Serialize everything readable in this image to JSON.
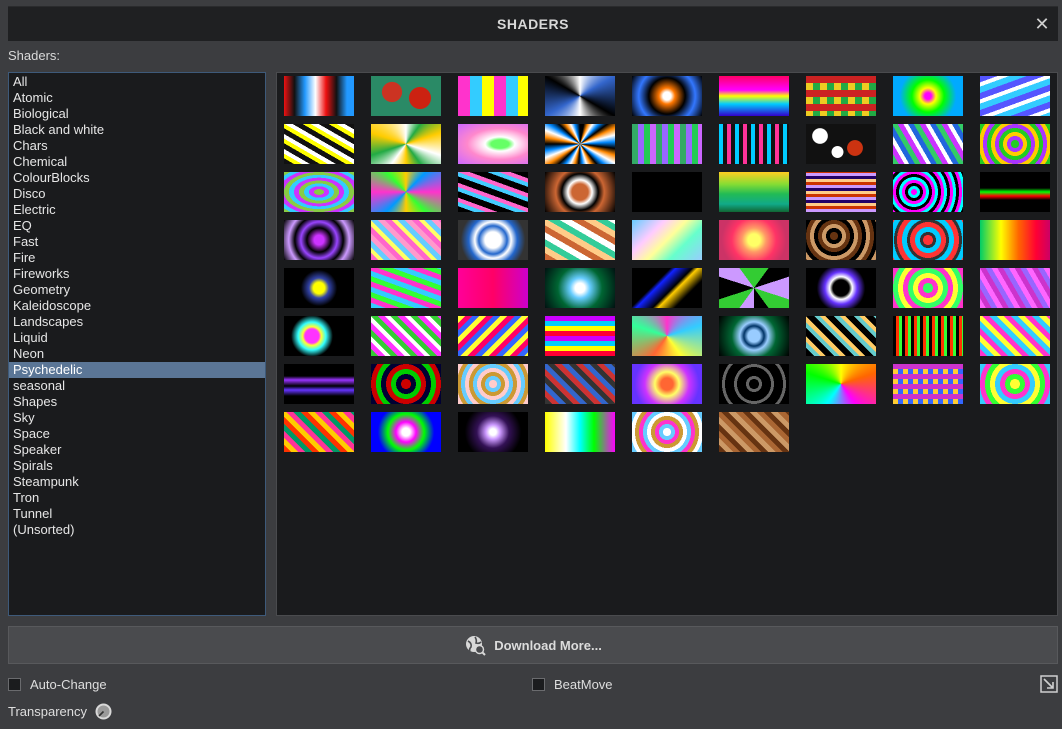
{
  "window": {
    "title": "SHADERS",
    "close_glyph": "✕"
  },
  "panel": {
    "shaders_label": "Shaders:"
  },
  "categories": {
    "selected": "Psychedelic",
    "items": [
      "All",
      "Atomic",
      "Biological",
      "Black and white",
      "Chars",
      "Chemical",
      "ColourBlocks",
      "Disco",
      "Electric",
      "EQ",
      "Fast",
      "Fire",
      "Fireworks",
      "Geometry",
      "Kaleidoscope",
      "Landscapes",
      "Liquid",
      "Neon",
      "Psychedelic",
      "seasonal",
      "Shapes",
      "Sky",
      "Space",
      "Speaker",
      "Spirals",
      "Steampunk",
      "Tron",
      "Tunnel",
      "(Unsorted)"
    ]
  },
  "thumbnails": [
    {
      "bg": "linear-gradient(90deg,#e11 0,#111 15%,#29f 30%,#fff 45%,#e11 60%,#111 75%,#29f 90%)"
    },
    {
      "bg": "radial-gradient(circle at 30% 40%,#c32 0 18%,transparent 19%),radial-gradient(circle at 70% 55%,#c21 0 20%,transparent 21%),#2a8a66"
    },
    {
      "bg": "repeating-linear-gradient(90deg,#f3c 0 12px,#3cf 12px 24px,#ff0 24px 36px)"
    },
    {
      "bg": "conic-gradient(#fff,#36c,#000,#fff,#36c,#000,#fff)"
    },
    {
      "bg": "radial-gradient(circle,#fff 0 10%,#f70 20%,#000 45%,#37f 70%,#000)"
    },
    {
      "bg": "linear-gradient(180deg,#f06 0,#f0f 35%,#ff0 50%,#0cf 70%,#30c 100%)"
    },
    {
      "bg": "repeating-conic-gradient(#c22 0 25%,#2a4 0 50%,#ec2 0 75%,#24c 0) 0 0/14px 14px"
    },
    {
      "bg": "radial-gradient(circle,#f0f 0 8%,#ff0 20%,#0f0 40%,#0af 70%)"
    },
    {
      "bg": "repeating-linear-gradient(160deg,#55f 0 6px,#fff 6px 10px,#3cf 10px 16px)"
    },
    {
      "bg": "repeating-linear-gradient(30deg,#111 0 5px,#ff0 5px 9px,#fff 9px 13px)"
    },
    {
      "bg": "conic-gradient(#fff,#2a4 10%,#fc0 20%,#fff 30%,#2a4 40%,#fc0 50%,#fff 60%,#2a4 70%,#fc0 80%,#fff)"
    },
    {
      "bg": "radial-gradient(ellipse at 60% 50%,#6f6 0 15%,#fff 25%,#f8c 55%,#c6f)"
    },
    {
      "bg": "conic-gradient(#000 0 3%,#f80 6%,#fff 9%,#08f 12%,#000 15%,#f80 18%,#fff 21%,#08f 24%,#000 27%,#f80 30%,#fff 33%,#08f 36%,#000 39%,#f80 42%,#fff 45%,#08f 48%,#000 51%,#f80 54%,#fff 57%,#08f 60%,#000 63%,#f80 66%,#fff 69%,#08f 72%,#000 75%,#f80 78%,#fff 81%,#08f 84%,#000 87%,#f80 90%,#fff 93%,#08f 96%,#000)"
    },
    {
      "bg": "repeating-linear-gradient(90deg,#3a6 0 6px,#96f 6px 12px,#2c5 12px 18px,#c6f 18px 24px)"
    },
    {
      "bg": "repeating-linear-gradient(90deg,#0cf 0 4px,#111 4px 8px,#f39 8px 12px,#111 12px 16px)"
    },
    {
      "bg": "radial-gradient(circle at 20% 30%,#fff 0 12%,transparent 13%),radial-gradient(circle at 70% 60%,#c31 0 14%,transparent 15%),radial-gradient(circle at 45% 70%,#fff 0 12%,transparent 13%),#111"
    },
    {
      "bg": "repeating-linear-gradient(60deg,#3c6 0 5px,#c3f 5px 10px,#fff 10px 14px,#26d 14px 19px)"
    },
    {
      "bg": "repeating-radial-gradient(circle,#2c2 0 4px,#a3f 4px 8px,#fc0 8px 12px)"
    },
    {
      "bg": "repeating-radial-gradient(ellipse,#8c4 0 5px,#c3f 5px 10px,#3cf 10px 15px)"
    },
    {
      "bg": "conic-gradient(#fc0,#09f,#f3c,#3f3,#fc0,#09f,#f3c,#3f3,#fc0)"
    },
    {
      "bg": "repeating-linear-gradient(200deg,#000 0 6px,#f6c 6px 10px,#4cf 10px 14px)"
    },
    {
      "bg": "radial-gradient(circle,#c63 0 20%,#fff 30%,#000 45%,#c63 60%,#000)"
    },
    {
      "bg": "#000"
    },
    {
      "bg": "linear-gradient(180deg,#fc2 0,#8d3 30%,#2b5 55%,#1a8 80%,#163 100%)"
    },
    {
      "bg": "repeating-linear-gradient(0deg,#c9f 0 3px,#c30 3px 6px,#fc8 6px 9px,#206 9px 12px)"
    },
    {
      "bg": "repeating-radial-gradient(circle at 30% 50%,#f0f 0 3px,#0ff 3px 6px,#000 6px 9px)"
    },
    {
      "bg": "linear-gradient(180deg,#000 0 40%,#0f0 50%,#f00 60%,#000 70%)"
    },
    {
      "bg": "radial-gradient(circle,#c3f 0 12%,#000 30%,#94f 45%,#000 60%,#c9f 75%,#000)"
    },
    {
      "bg": "repeating-linear-gradient(45deg,#f6c 0 5px,#ff6 5px 9px,#6cf 9px 14px,#f9c 14px 19px)"
    },
    {
      "bg": "radial-gradient(circle,#fff 0 20%,#26c 35%,#fff 45%,#26c 60%,#333 80%)"
    },
    {
      "bg": "repeating-linear-gradient(30deg,#c63 0 6px,#fc8 6px 12px,#3c9 12px 18px,#fff 18px 24px)"
    },
    {
      "bg": "linear-gradient(135deg,#6cf 0,#fcf 30%,#ff9 50%,#6fc 70%,#9cf 100%)"
    },
    {
      "bg": "radial-gradient(circle,#ff6 0 15%,#f96 30%,#f36 55%,#c36 80%)"
    },
    {
      "bg": "repeating-radial-gradient(circle at 40% 40%,#631 0 4px,#000 4px 8px,#c96 8px 12px)"
    },
    {
      "bg": "repeating-radial-gradient(circle,#f33 0 5px,#333 5px 8px,#0cf 8px 13px)"
    },
    {
      "bg": "linear-gradient(90deg,#0c6 0,#ff0 30%,#f60 55%,#f03 80%,#c06 100%)"
    },
    {
      "bg": "radial-gradient(circle,#ff0 0 14%,#34a 25%,#000 45%,#000)"
    },
    {
      "bg": "repeating-linear-gradient(20deg,#3cf 0 5px,#f3c 5px 10px,#3f3 10px 15px)"
    },
    {
      "bg": "linear-gradient(90deg,#f09 0,#f06 50%,#c0c 100%)"
    },
    {
      "bg": "radial-gradient(circle,#fff 0 12%,#6cf 25%,#063 55%,#011)"
    },
    {
      "bg": "linear-gradient(135deg,#000 0 35%,#12f 40%,#000 55%,#fc0 60%,#000 75%)"
    },
    {
      "bg": "repeating-conic-gradient(#3c3 0 10%,#000 10% 20%,#c9f 20% 30%)"
    },
    {
      "bg": "radial-gradient(circle,#000 0 20%,#fff 28%,#63f 40%,#000 60%)"
    },
    {
      "bg": "repeating-radial-gradient(circle,#3f6 0 5px,#f3c 5px 10px,#ff3 10px 15px)"
    },
    {
      "bg": "repeating-linear-gradient(60deg,#f6f 0 5px,#c3c 5px 10px,#96f 10px 15px)"
    },
    {
      "bg": "radial-gradient(circle at 40% 50%,#f3f 0 15%,#ff3 20%,#3ff 30%,#000 45%)"
    },
    {
      "bg": "repeating-linear-gradient(45deg,#3c3 0 5px,#f3f 5px 10px,#fff 10px 14px)"
    },
    {
      "bg": "repeating-linear-gradient(135deg,#ff3 0 5px,#f06 5px 10px,#36f 10px 15px)"
    },
    {
      "bg": "repeating-linear-gradient(0deg,#f03 0 5px,#ff0 5px 10px,#0cf 10px 15px,#c0f 15px 20px)"
    },
    {
      "bg": "conic-gradient(#f3c,#3cf,#ff3,#f63,#3f9,#f3c)"
    },
    {
      "bg": "radial-gradient(circle,#9cf 0 15%,#036 25%,#9cf 35%,#063 55%,#000)"
    },
    {
      "bg": "repeating-linear-gradient(45deg,#000 0 6px,#6cc 6px 10px,#fc6 10px 14px)"
    },
    {
      "bg": "repeating-linear-gradient(90deg,#000 0 3px,#f30 3px 6px,#3f3 6px 9px)"
    },
    {
      "bg": "repeating-linear-gradient(45deg,#f3c 0 5px,#3cf 5px 10px,#ff3 10px 15px)"
    },
    {
      "bg": "linear-gradient(180deg,#000 0 30%,#93f 40%,#000 55%,#63f 65%,#000 80%)"
    },
    {
      "bg": "repeating-radial-gradient(circle,#c00 0 5px,#003 5px 10px,#0c0 10px 15px)"
    },
    {
      "bg": "repeating-radial-gradient(circle,#fcc 0 4px,#6cf 4px 8px,#c93 8px 12px)"
    },
    {
      "bg": "repeating-linear-gradient(45deg,#333 0 5px,#c33 5px 10px,#36c 10px 15px)"
    },
    {
      "bg": "radial-gradient(circle,#f63 0 15%,#ff6 30%,#c3f 55%,#63f 80%)"
    },
    {
      "bg": "repeating-radial-gradient(circle,#000 0 5px,#666 5px 8px,#000 8px 12px)"
    },
    {
      "bg": "conic-gradient(#ff0,#f60,#f0f,#0ff,#0f0,#ff0)"
    },
    {
      "bg": "repeating-conic-gradient(#c3c 0 25%,#36f 0 50%,#fc3 0 75%,#3c9 0) 0 0/10px 10px"
    },
    {
      "bg": "repeating-radial-gradient(circle,#ff3 0 5px,#3f3 5px 10px,#f3c 10px 15px,#3cf 15px 20px)"
    },
    {
      "bg": "repeating-linear-gradient(45deg,#f30 0 5px,#fc0 5px 10px,#f39 10px 15px,#096 15px 20px)"
    },
    {
      "bg": "radial-gradient(circle,#fff 0 10%,#f0f 25%,#0f0 45%,#00f 70%)"
    },
    {
      "bg": "radial-gradient(circle,#fff 0 8%,#c9f 18%,#315 40%,#000 70%)"
    },
    {
      "bg": "linear-gradient(90deg,#ff0 0,#fff 30%,#0ff 50%,#0f0 70%,#f0f 100%)"
    },
    {
      "bg": "repeating-radial-gradient(circle,#fff 0 4px,#6cf 4px 8px,#f3c 8px 12px,#c93 12px 16px)"
    },
    {
      "bg": "repeating-linear-gradient(45deg,#631 0 5px,#c96 5px 10px,#a63 10px 15px)"
    }
  ],
  "footer": {
    "download_label": "Download More...",
    "auto_change_label": "Auto-Change",
    "auto_change_checked": false,
    "beatmove_label": "BeatMove",
    "beatmove_checked": false,
    "transparency_label": "Transparency"
  },
  "colors": {
    "selection": "#5b7696",
    "list_border": "#3e5a7a"
  }
}
